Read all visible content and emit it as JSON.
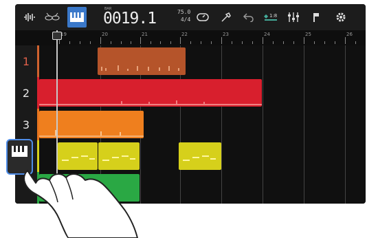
{
  "toolbar": {
    "counter_prefix": "BAR",
    "counter": "0019.1",
    "tempo_value": "75.0",
    "time_signature": "4/4",
    "icons": [
      "waveform-icon",
      "drum-icon",
      "piano-icon",
      "metronome-icon",
      "effects-icon",
      "undo-icon",
      "quantize-icon",
      "mixer-icon",
      "marker-icon",
      "settings-icon"
    ]
  },
  "ruler": {
    "bars": [
      "19",
      "20",
      "21",
      "22",
      "23",
      "24",
      "25",
      "26"
    ]
  },
  "tracks": [
    {
      "number": "1",
      "color": "#d0622f",
      "type": "audio"
    },
    {
      "number": "2",
      "color": "#d9202e",
      "type": "audio"
    },
    {
      "number": "3",
      "color": "#e9751e",
      "type": "audio"
    },
    {
      "number": "",
      "color": "#d6d01b",
      "type": "instrument"
    },
    {
      "number": "",
      "color": "#2aa844",
      "type": "instrument"
    }
  ],
  "accent_color": "#3a78c9"
}
